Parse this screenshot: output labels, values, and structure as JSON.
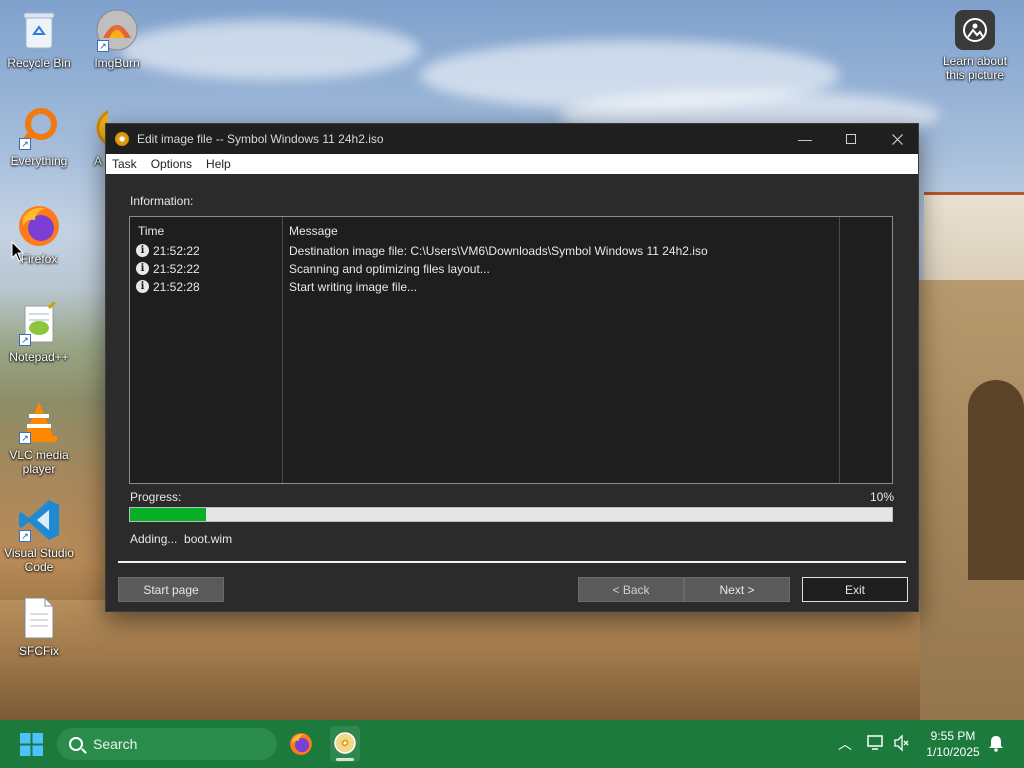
{
  "desktop": {
    "icons": [
      {
        "label": "Recycle Bin",
        "icon": "recycle-bin-icon"
      },
      {
        "label": "ImgBurn",
        "icon": "imgburn-icon"
      },
      {
        "label": "Everything",
        "icon": "everything-search-icon"
      },
      {
        "label": "A",
        "icon": "app-icon"
      },
      {
        "label": "Firefox",
        "icon": "firefox-icon"
      },
      {
        "label": "Notepad++",
        "icon": "notepad-plus-plus-icon"
      },
      {
        "label": "VLC media player",
        "icon": "vlc-icon"
      },
      {
        "label": "Visual Studio Code",
        "icon": "vscode-icon"
      },
      {
        "label": "SFCFix",
        "icon": "document-icon"
      }
    ],
    "learn_about": "Learn about this picture"
  },
  "window": {
    "title": "Edit image file -- Symbol Windows 11 24h2.iso",
    "menu": [
      "Task",
      "Options",
      "Help"
    ],
    "information_label": "Information:",
    "columns": {
      "time": "Time",
      "message": "Message"
    },
    "log": [
      {
        "time": "21:52:22",
        "message": "Destination image file:  C:\\Users\\VM6\\Downloads\\Symbol Windows 11 24h2.iso"
      },
      {
        "time": "21:52:22",
        "message": "Scanning and optimizing files layout..."
      },
      {
        "time": "21:52:28",
        "message": "Start writing image file..."
      }
    ],
    "progress_label": "Progress:",
    "progress_text": "10%",
    "progress_value": 0.1,
    "status_action": "Adding...",
    "status_file": "boot.wim",
    "buttons": {
      "start_page": "Start page",
      "back": "< Back",
      "next": "Next >",
      "exit": "Exit"
    }
  },
  "taskbar": {
    "search_placeholder": "Search",
    "time": "9:55 PM",
    "date": "1/10/2025"
  },
  "colors": {
    "taskbar": "#1b7a3c",
    "progress_fill": "#06b025",
    "window_bg": "#2b2b2b"
  }
}
